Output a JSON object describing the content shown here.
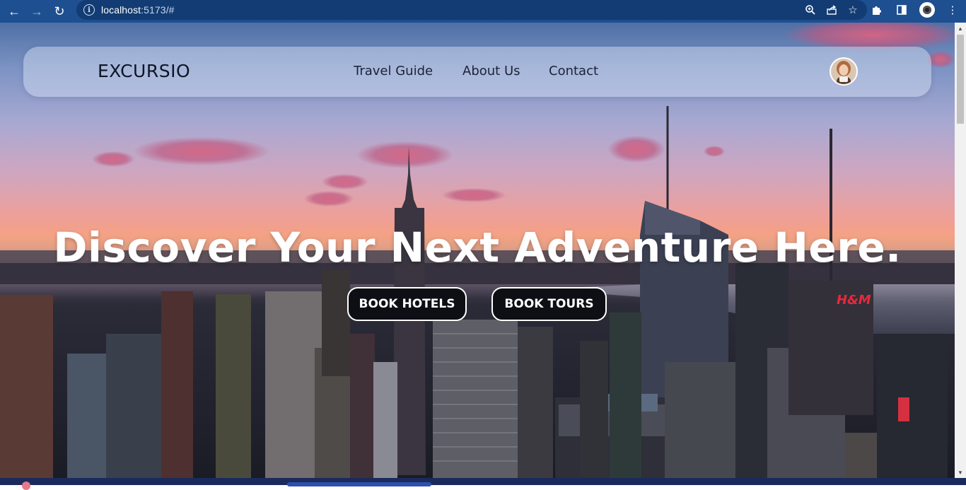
{
  "browser": {
    "url_host": "localhost",
    "url_rest": ":5173/#",
    "back_icon": "arrow-left-icon",
    "forward_icon": "arrow-right-icon",
    "reload_icon": "reload-icon",
    "site_info_icon": "info-icon",
    "zoom_icon": "zoom-icon",
    "share_icon": "share-icon",
    "bookmark_icon": "star-icon",
    "extensions_icon": "puzzle-icon",
    "sidepanel_icon": "side-panel-icon",
    "profile_icon": "profile-icon",
    "menu_icon": "kebab-menu-icon"
  },
  "navbar": {
    "brand": "EXCURSIO",
    "links": [
      "Travel Guide",
      "About Us",
      "Contact"
    ],
    "avatar_icon": "user-avatar"
  },
  "hero": {
    "title": "Discover Your Next Adventure Here.",
    "buttons": [
      "BOOK HOTELS",
      "BOOK TOURS"
    ]
  },
  "colors": {
    "chrome": "#1d4f91",
    "omnibox": "#123c73",
    "button_bg": "#0d0f14",
    "button_border": "#ffffff",
    "hero_text": "#ffffff"
  }
}
